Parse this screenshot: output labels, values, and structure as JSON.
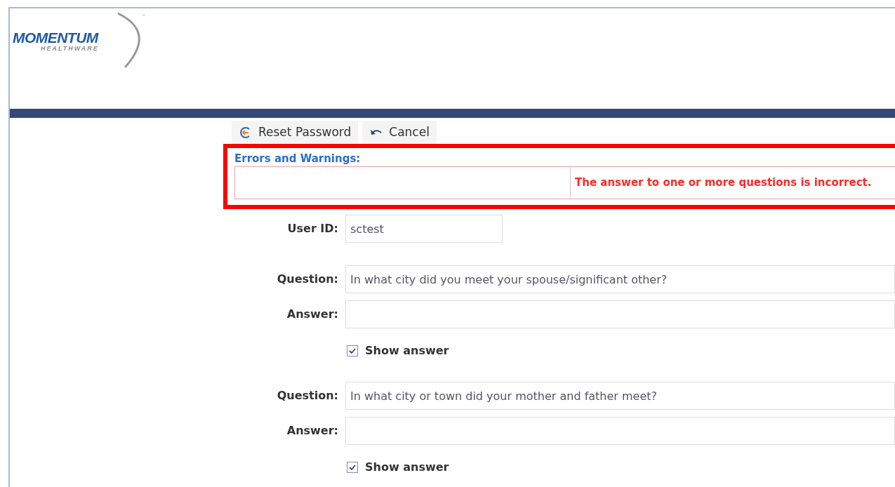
{
  "logo": {
    "name": "MOMENTUM",
    "tagline": "HEALTHWARE",
    "mark": "™"
  },
  "toolbar": [
    {
      "kind": "reset",
      "label": "Reset Password"
    },
    {
      "kind": "cancel",
      "label": "Cancel"
    }
  ],
  "errors": {
    "title": "Errors and Warnings:",
    "message": "The answer to one or more questions is incorrect."
  },
  "user_id": {
    "label": "User ID:",
    "value": "sctest"
  },
  "questions": [
    {
      "question_label": "Question:",
      "question": "In what city did you meet your spouse/significant other?",
      "answer_label": "Answer:",
      "show_answer": {
        "label": "Show answer",
        "checked": true
      }
    },
    {
      "question_label": "Question:",
      "question": "In what city or town did your mother and father meet?",
      "answer_label": "Answer:",
      "show_answer": {
        "label": "Show answer",
        "checked": true
      }
    }
  ]
}
